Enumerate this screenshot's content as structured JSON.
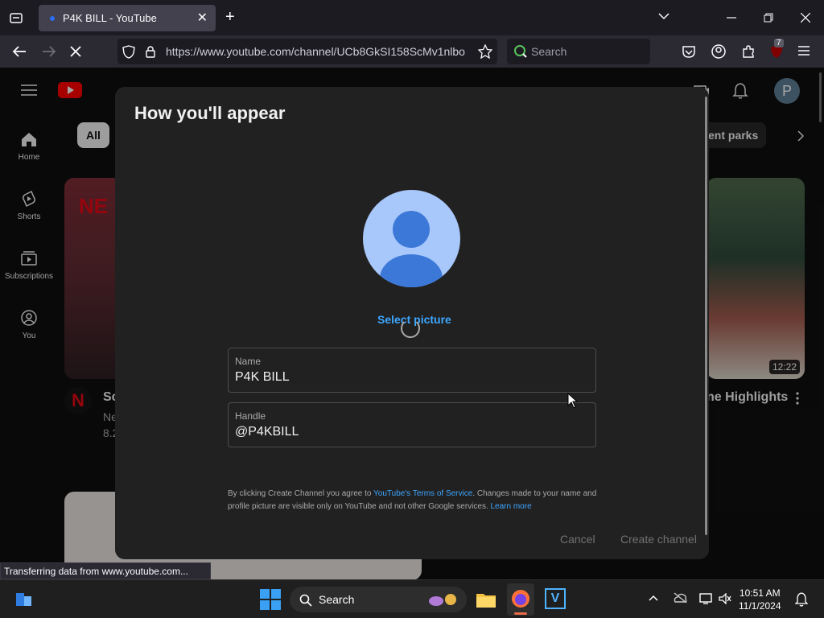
{
  "browser": {
    "tab_title": "P4K BILL - YouTube",
    "url": "https://www.youtube.com/channel/UCb8GkSI158ScMv1nlbo",
    "search_placeholder": "Search",
    "extension_badge": "7"
  },
  "youtube": {
    "sidebar": [
      {
        "label": "Home",
        "icon": "home-icon"
      },
      {
        "label": "Shorts",
        "icon": "shorts-icon"
      },
      {
        "label": "Subscriptions",
        "icon": "subscriptions-icon"
      },
      {
        "label": "You",
        "icon": "you-icon"
      }
    ],
    "chips": {
      "all": "All",
      "partial": "ent parks"
    },
    "avatar_letter": "P",
    "video_right": {
      "duration": "12:22",
      "title_partial": "ne Highlights"
    },
    "video_left": {
      "title_partial": "Sc",
      "channel_partial": "Ne",
      "stats_partial": "8.2"
    }
  },
  "dialog": {
    "title": "How you'll appear",
    "select_picture": "Select picture",
    "name_label": "Name",
    "name_value": "P4K BILL",
    "handle_label": "Handle",
    "handle_value": "@P4KBILL",
    "terms_1": "By clicking Create Channel you agree to ",
    "terms_link": "YouTube's Terms of Service",
    "terms_2": ". Changes made to your name and profile picture are visible only on YouTube and not other Google services. ",
    "learn_more": "Learn more",
    "cancel": "Cancel",
    "create": "Create channel"
  },
  "status_text": "Transferring data from www.youtube.com...",
  "taskbar": {
    "search_placeholder": "Search",
    "time": "10:51 AM",
    "date": "11/1/2024"
  }
}
